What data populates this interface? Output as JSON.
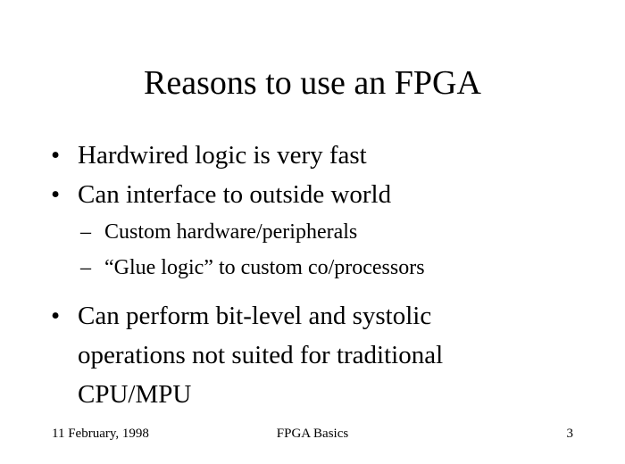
{
  "slide": {
    "title": "Reasons to use an FPGA",
    "bullets": [
      {
        "marker": "•",
        "text": "Hardwired logic is very fast"
      },
      {
        "marker": "•",
        "text": "Can interface to outside world",
        "sub": [
          {
            "marker": "–",
            "text": "Custom hardware/peripherals"
          },
          {
            "marker": "–",
            "text": "“Glue logic” to custom co/processors"
          }
        ]
      },
      {
        "marker": "•",
        "lines": [
          "Can perform bit-level and systolic",
          "operations not suited for traditional",
          "CPU/MPU"
        ]
      }
    ]
  },
  "footer": {
    "date": "11 February, 1998",
    "topic": "FPGA Basics",
    "page_number": "3"
  }
}
